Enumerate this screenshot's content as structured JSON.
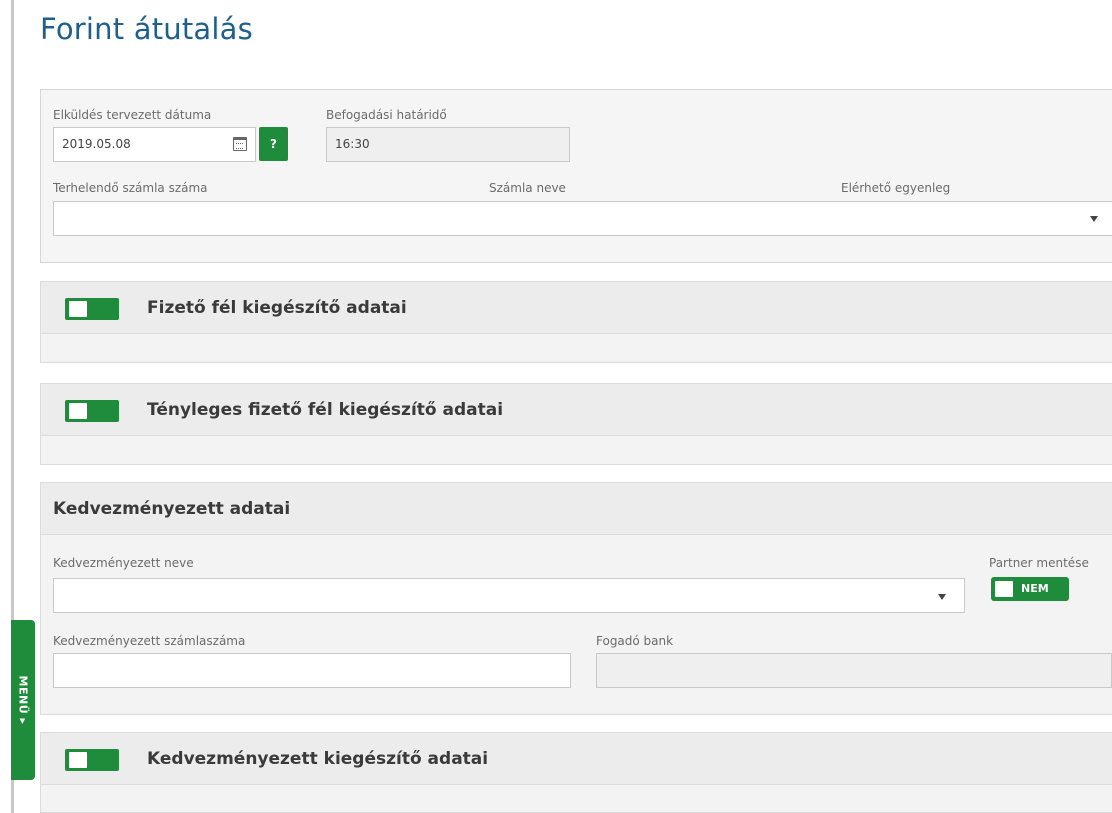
{
  "page": {
    "title": "Forint átutalás"
  },
  "transfer": {
    "send_date_label": "Elküldés tervezett dátuma",
    "send_date_value": "2019.05.08",
    "help_label": "?",
    "deadline_label": "Befogadási határidő",
    "deadline_value": "16:30",
    "debit_account_label": "Terhelendő számla száma",
    "account_name_label": "Számla neve",
    "available_balance_label": "Elérhető egyenleg",
    "debit_account_value": ""
  },
  "sections": {
    "payer_extra": {
      "title": "Fizető fél kiegészítő adatai"
    },
    "actual_payer_extra": {
      "title": "Tényleges fizető fél kiegészítő adatai"
    },
    "beneficiary": {
      "title": "Kedvezményezett adatai",
      "name_label": "Kedvezményezett neve",
      "name_value": "",
      "partner_save_label": "Partner mentése",
      "partner_save_toggle": "NEM",
      "account_number_label": "Kedvezményezett számlaszáma",
      "account_number_value": "",
      "receiving_bank_label": "Fogadó bank",
      "receiving_bank_value": ""
    },
    "beneficiary_extra": {
      "title": "Kedvezményezett kiegészítő adatai"
    }
  },
  "side_menu": {
    "label": "MENÜ ▸"
  },
  "colors": {
    "accent_green": "#1e8c3a",
    "title_blue": "#1f5f8b"
  },
  "icons": {
    "calendar": "calendar-icon",
    "dropdown": "chevron-down-icon"
  }
}
